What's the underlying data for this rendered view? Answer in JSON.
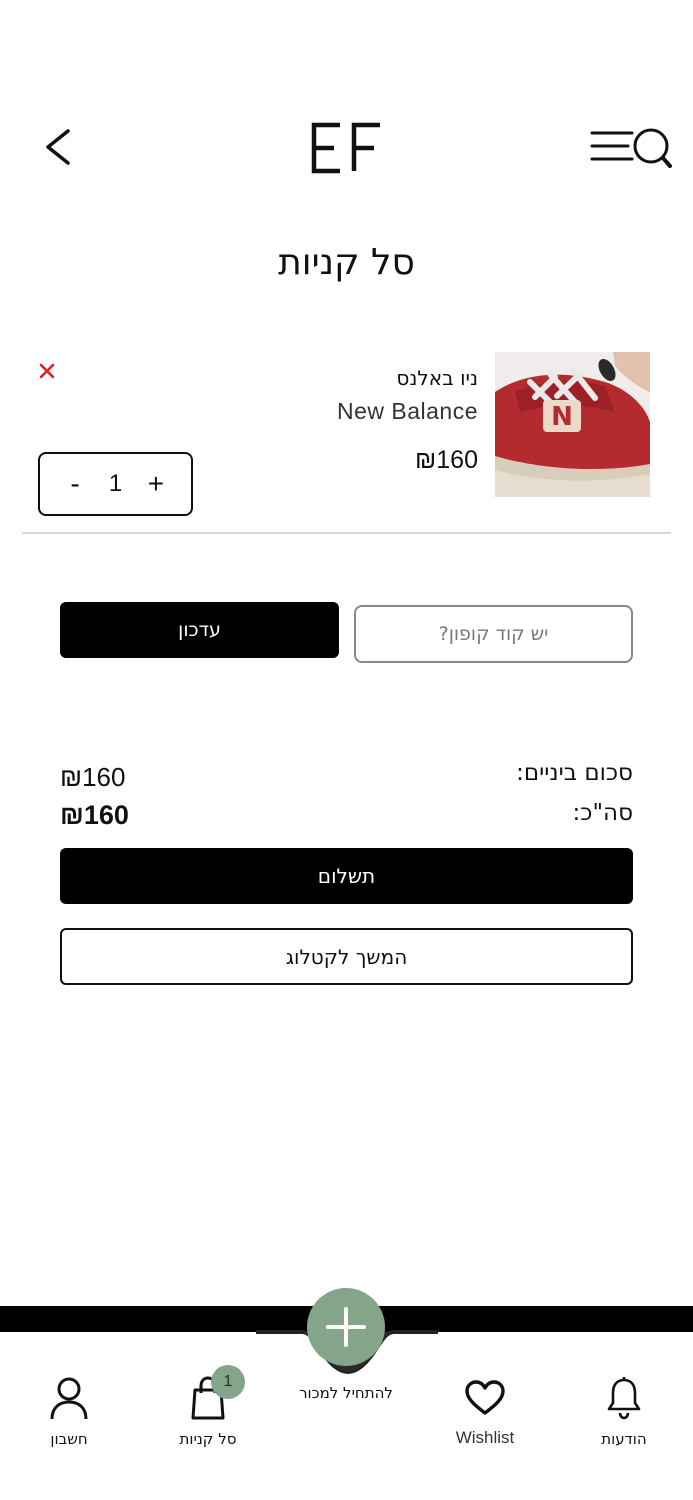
{
  "header": {
    "back_icon": "chevron-left-icon",
    "logo_text": "EF",
    "menu_icon": "menu-search-icon"
  },
  "page": {
    "title": "סל קניות"
  },
  "cart_item": {
    "name": "ניו באלנס",
    "brand": "New Balance",
    "price": "₪160",
    "quantity": "1",
    "minus_label": "-",
    "plus_label": "+",
    "remove_icon": "close-icon",
    "remove_color": "#e02020"
  },
  "coupon": {
    "placeholder": "יש קוד קופון?",
    "update_label": "עדכון"
  },
  "totals": {
    "subtotal_label": "סכום ביניים:",
    "subtotal_value": "₪160",
    "total_label": "סה\"כ:",
    "total_value": "₪160"
  },
  "actions": {
    "pay_label": "תשלום",
    "continue_label": "המשך לקטלוג"
  },
  "bottom_nav": {
    "account_label": "חשבון",
    "cart_label": "סל קניות",
    "cart_badge": "1",
    "sell_label": "להתחיל למכור",
    "wishlist_label": "Wishlist",
    "notifications_label": "הודעות",
    "fab_color": "#84a58a"
  }
}
